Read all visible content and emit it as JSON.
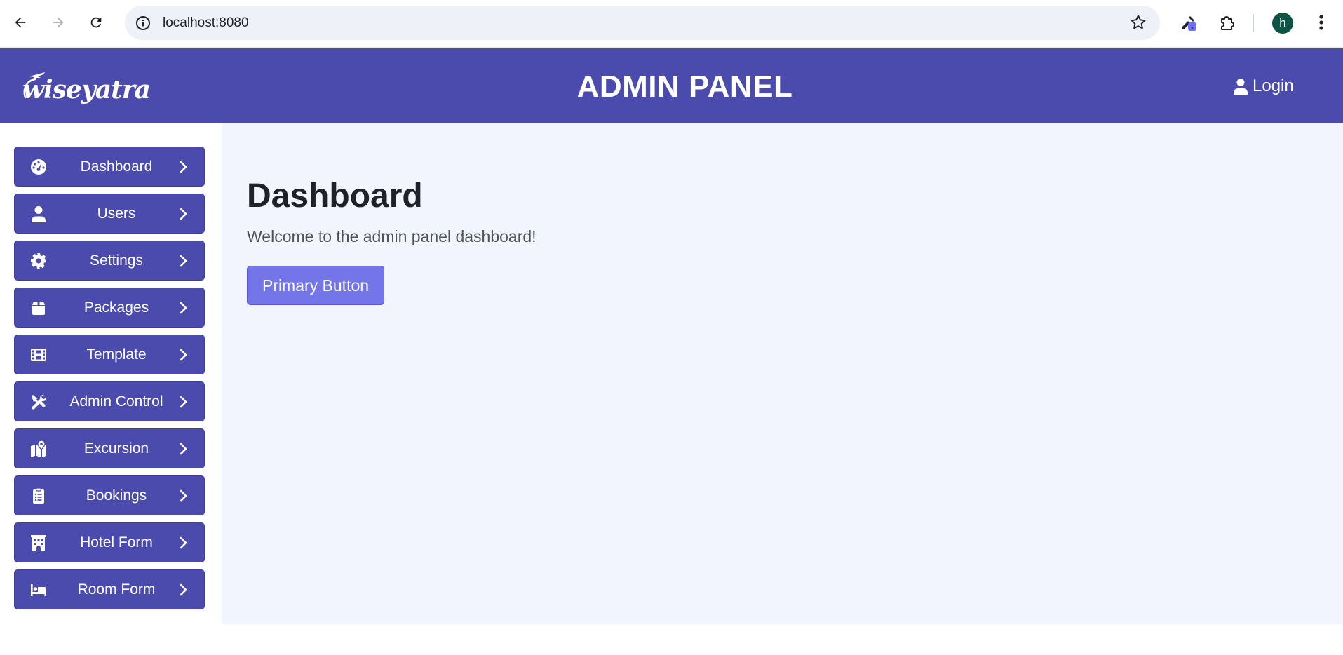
{
  "browser": {
    "url": "localhost:8080",
    "avatar_initial": "h"
  },
  "header": {
    "logo_text": "wiseyatra",
    "title": "ADMIN PANEL",
    "login_label": "Login"
  },
  "sidebar": {
    "items": [
      {
        "label": "Dashboard",
        "icon": "gauge-icon"
      },
      {
        "label": "Users",
        "icon": "user-icon"
      },
      {
        "label": "Settings",
        "icon": "gear-icon"
      },
      {
        "label": "Packages",
        "icon": "package-icon"
      },
      {
        "label": "Template",
        "icon": "film-icon"
      },
      {
        "label": "Admin Control",
        "icon": "tools-icon"
      },
      {
        "label": "Excursion",
        "icon": "map-location-icon"
      },
      {
        "label": "Bookings",
        "icon": "clipboard-list-icon"
      },
      {
        "label": "Hotel Form",
        "icon": "hotel-icon"
      },
      {
        "label": "Room Form",
        "icon": "bed-icon"
      }
    ]
  },
  "main": {
    "title": "Dashboard",
    "welcome": "Welcome to the admin panel dashboard!",
    "primary_button": "Primary Button"
  },
  "colors": {
    "header_bg": "#4b4aad",
    "sidebar_item_bg": "#4b4aad",
    "main_bg": "#f2f5fe",
    "primary_button_bg": "#7375e8"
  }
}
